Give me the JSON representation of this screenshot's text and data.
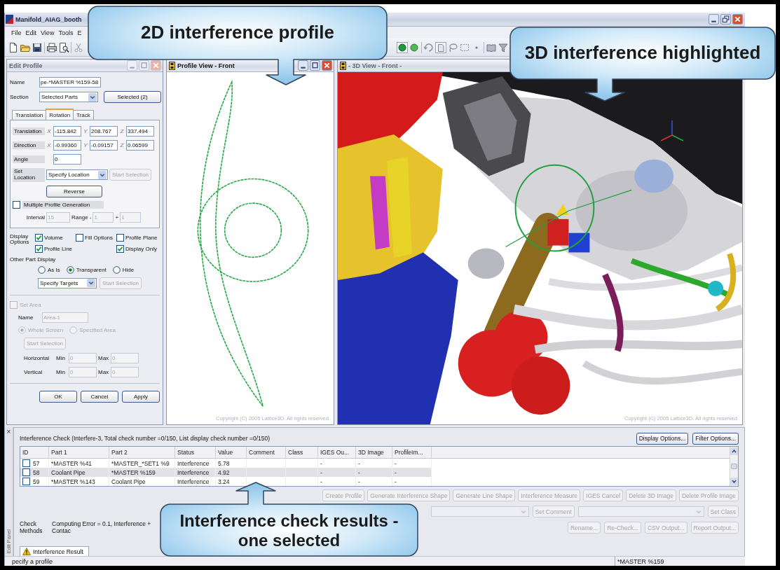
{
  "window": {
    "title": "Manifold_AIAG_booth"
  },
  "menu": [
    "File",
    "Edit",
    "View",
    "Tools",
    "E"
  ],
  "edit_profile": {
    "title": "Edit Profile",
    "active": false,
    "name": {
      "label": "Name",
      "value": "pe-*MASTER %159-58"
    },
    "section": {
      "label": "Section",
      "value": "Selected Parts",
      "button": "Selected (2)"
    },
    "tabs": [
      {
        "label": "Translation",
        "selected": false
      },
      {
        "label": "Rotation",
        "selected": true
      },
      {
        "label": "Track",
        "selected": false
      }
    ],
    "vectors": [
      {
        "label": "Translation",
        "components": [
          {
            "axis": "X",
            "value": "-115.842"
          },
          {
            "axis": "Y",
            "value": "208.767"
          },
          {
            "axis": "Z",
            "value": "337.494"
          }
        ]
      },
      {
        "label": "Direction",
        "components": [
          {
            "axis": "X",
            "value": "-0.99360"
          },
          {
            "axis": "Y",
            "value": "-0.09157"
          },
          {
            "axis": "Z",
            "value": "0.06599"
          }
        ]
      }
    ],
    "angle": {
      "label": "Angle",
      "value": "0"
    },
    "set_location": {
      "label": "Set Location",
      "value": "Specify Location",
      "button": {
        "label": "Start Selection",
        "disabled": true
      }
    },
    "reverse": "Reverse",
    "multiple_profile": {
      "label": "Multiple Profile Generation",
      "checked": false
    },
    "interval": {
      "label": "Interval",
      "value": "15",
      "range_label": "Range -",
      "range_from": "1",
      "plus": "+",
      "range_to": "1",
      "disabled": true
    },
    "display_options": {
      "label": "Display Options",
      "items": [
        {
          "label": "Volume",
          "checked": true
        },
        {
          "label": "Fill Options",
          "checked": false
        },
        {
          "label": "Profile Plane",
          "checked": false
        },
        {
          "label": "Profile Line",
          "checked": true
        },
        {
          "label": "Display Only",
          "checked": true
        }
      ]
    },
    "other_part_display": {
      "label": "Other Part Display",
      "options": [
        {
          "label": "As Is",
          "selected": false
        },
        {
          "label": "Transparent",
          "selected": true
        },
        {
          "label": "Hide",
          "selected": false
        }
      ],
      "target": "Specify Targets",
      "button": {
        "label": "Start Selection",
        "disabled": true
      }
    },
    "set_area": {
      "label": "Set Area",
      "checked": false,
      "disabled": true,
      "name_label": "Name",
      "name_value": "Area-1",
      "options": [
        {
          "label": "Whole Screen",
          "selected": true
        },
        {
          "label": "Specified Area",
          "selected": false
        }
      ],
      "button": "Start Selection",
      "ranges": [
        {
          "label": "Horizontal",
          "min_label": "Min",
          "min": "0",
          "max_label": "Max",
          "max": "0"
        },
        {
          "label": "Vertical",
          "min_label": "Min",
          "min": "0",
          "max_label": "Max",
          "max": "0"
        }
      ]
    },
    "buttons": [
      "OK",
      "Cancel",
      "Apply"
    ]
  },
  "profile_view": {
    "title": "Profile View - Front",
    "active": true,
    "copyright": "Copyright (C) 2005 Lattice3D. All rights reserved."
  },
  "view_3d": {
    "title": "- 3D View - Front -",
    "active": false,
    "copyright": "Copyright (C) 2005 Lattice3D. All rights reserved."
  },
  "side_strip": {
    "close": "×",
    "label": "Edit Panel"
  },
  "interference": {
    "summary": "Interference Check (Interfere-3,  Total check number =0/150,  List display check number =0/150)",
    "option_buttons": [
      "Display Options...",
      "Filter Options..."
    ],
    "columns": [
      "ID",
      "Part 1",
      "Part 2",
      "Status",
      "Value",
      "Comment",
      "Class",
      "IGES Ou...",
      "3D Image",
      "ProfileIm..."
    ],
    "rows": [
      {
        "checked": false,
        "selected": false,
        "id": "57",
        "part_1": "*MASTER %41",
        "part_2": "*MASTER_*SET1 %9",
        "status": "Interference",
        "value": "5.78",
        "iges": "-",
        "image_3d": "-",
        "profile_image": "-"
      },
      {
        "checked": false,
        "selected": true,
        "id": "58",
        "part_1": "Coolant Pipe",
        "part_2": "*MASTER %159",
        "status": "Interference",
        "value": "4.92",
        "iges": "-",
        "image_3d": "-",
        "profile_image": "-"
      },
      {
        "checked": false,
        "selected": false,
        "id": "59",
        "part_1": "*MASTER %143",
        "part_2": "Coolant Pipe",
        "status": "Interference",
        "value": "3.24",
        "iges": "-",
        "image_3d": "-",
        "profile_image": "-"
      }
    ],
    "action_buttons": [
      {
        "label": "Create Profile",
        "disabled": true
      },
      {
        "label": "Generate Interference Shape",
        "disabled": true
      },
      {
        "label": "Generate Line Shape",
        "disabled": true
      },
      {
        "label": "Interference Measure",
        "disabled": true
      },
      {
        "label": "IGES Cancel",
        "disabled": true
      },
      {
        "label": "Delete 3D Image",
        "disabled": true
      },
      {
        "label": "Delete Profile Image",
        "disabled": true
      }
    ],
    "comment_select": {
      "disabled": true
    },
    "comment_button": {
      "label": "Set Comment",
      "disabled": true
    },
    "class_select": {
      "disabled": true
    },
    "class_button": {
      "label": "Set Class",
      "disabled": true
    },
    "check_methods": {
      "label": "Check Methods",
      "value": "Computing Error = 0.1, Interference + Contac"
    },
    "output_buttons": [
      {
        "label": "Rename...",
        "disabled": true
      },
      {
        "label": "Re-Check...",
        "disabled": true
      },
      {
        "label": "CSV Output...",
        "disabled": true
      },
      {
        "label": "Report Output...",
        "disabled": true
      }
    ],
    "result_tab": {
      "label": "Interference Result",
      "selected": true
    }
  },
  "status_bar": {
    "message": "pecify a profile",
    "part": "*MASTER %159"
  },
  "callouts": [
    {
      "lines": [
        "2D interference profile"
      ]
    },
    {
      "lines": [
        "3D interference highlighted"
      ]
    },
    {
      "lines": [
        "Interference check results -",
        "one selected"
      ]
    }
  ]
}
